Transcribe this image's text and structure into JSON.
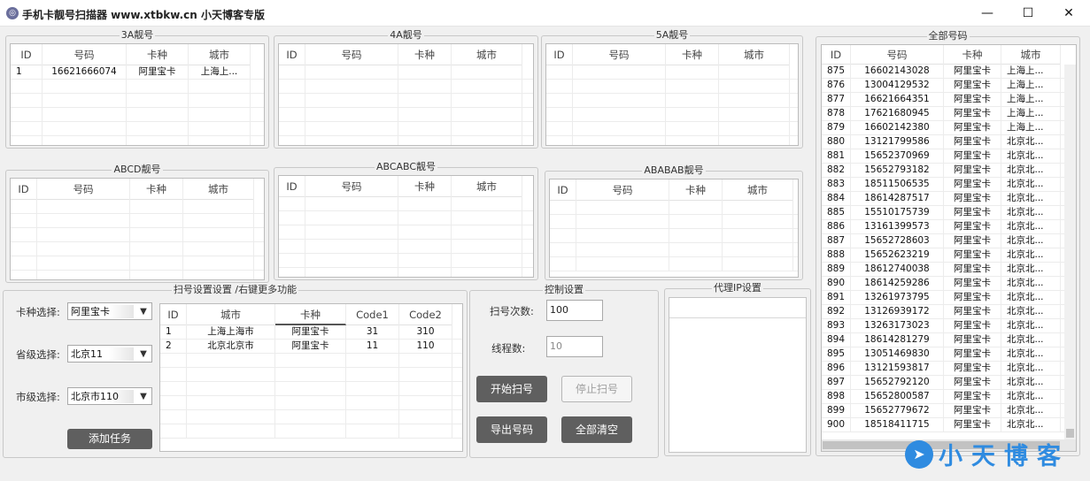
{
  "window": {
    "title": "手机卡靓号扫描器  www.xtbkw.cn  小天博客专版",
    "minimize": "—",
    "maximize": "☐",
    "close": "✕"
  },
  "groups": {
    "g3a": "3A靓号",
    "g4a": "4A靓号",
    "g5a": "5A靓号",
    "gabcd": "ABCD靓号",
    "gabcabc": "ABCABC靓号",
    "gababab": "ABABAB靓号",
    "gall": "全部号码",
    "gscan": "扫号设置设置 /右键更多功能",
    "gctrl": "控制设置",
    "gproxy": "代理IP设置"
  },
  "grid_headers": {
    "id": "ID",
    "number": "号码",
    "card": "卡种",
    "city": "城市"
  },
  "grid_3a_rows": [
    {
      "id": "1",
      "number": "16621666074",
      "card": "阿里宝卡",
      "city": "上海上..."
    }
  ],
  "settings": {
    "card_label": "卡种选择:",
    "card_value": "阿里宝卡",
    "province_label": "省级选择:",
    "province_value": "北京11",
    "city_label": "市级选择:",
    "city_value": "北京市110",
    "add_task": "添加任务"
  },
  "task_grid": {
    "headers": {
      "id": "ID",
      "city": "城市",
      "card": "卡种",
      "code1": "Code1",
      "code2": "Code2"
    },
    "rows": [
      {
        "id": "1",
        "city": "上海上海市",
        "card": "阿里宝卡",
        "code1": "31",
        "code2": "310"
      },
      {
        "id": "2",
        "city": "北京北京市",
        "card": "阿里宝卡",
        "code1": "11",
        "code2": "110"
      }
    ]
  },
  "control": {
    "scan_count_label": "扫号次数:",
    "scan_count_value": "100",
    "threads_label": "线程数:",
    "threads_value": "10",
    "start": "开始扫号",
    "stop": "停止扫号",
    "export": "导出号码",
    "clear": "全部清空"
  },
  "all_numbers": [
    {
      "id": "875",
      "number": "16602143028",
      "card": "阿里宝卡",
      "city": "上海上..."
    },
    {
      "id": "876",
      "number": "13004129532",
      "card": "阿里宝卡",
      "city": "上海上..."
    },
    {
      "id": "877",
      "number": "16621664351",
      "card": "阿里宝卡",
      "city": "上海上..."
    },
    {
      "id": "878",
      "number": "17621680945",
      "card": "阿里宝卡",
      "city": "上海上..."
    },
    {
      "id": "879",
      "number": "16602142380",
      "card": "阿里宝卡",
      "city": "上海上..."
    },
    {
      "id": "880",
      "number": "13121799586",
      "card": "阿里宝卡",
      "city": "北京北..."
    },
    {
      "id": "881",
      "number": "15652370969",
      "card": "阿里宝卡",
      "city": "北京北..."
    },
    {
      "id": "882",
      "number": "15652793182",
      "card": "阿里宝卡",
      "city": "北京北..."
    },
    {
      "id": "883",
      "number": "18511506535",
      "card": "阿里宝卡",
      "city": "北京北..."
    },
    {
      "id": "884",
      "number": "18614287517",
      "card": "阿里宝卡",
      "city": "北京北..."
    },
    {
      "id": "885",
      "number": "15510175739",
      "card": "阿里宝卡",
      "city": "北京北..."
    },
    {
      "id": "886",
      "number": "13161399573",
      "card": "阿里宝卡",
      "city": "北京北..."
    },
    {
      "id": "887",
      "number": "15652728603",
      "card": "阿里宝卡",
      "city": "北京北..."
    },
    {
      "id": "888",
      "number": "15652623219",
      "card": "阿里宝卡",
      "city": "北京北..."
    },
    {
      "id": "889",
      "number": "18612740038",
      "card": "阿里宝卡",
      "city": "北京北..."
    },
    {
      "id": "890",
      "number": "18614259286",
      "card": "阿里宝卡",
      "city": "北京北..."
    },
    {
      "id": "891",
      "number": "13261973795",
      "card": "阿里宝卡",
      "city": "北京北..."
    },
    {
      "id": "892",
      "number": "13126939172",
      "card": "阿里宝卡",
      "city": "北京北..."
    },
    {
      "id": "893",
      "number": "13263173023",
      "card": "阿里宝卡",
      "city": "北京北..."
    },
    {
      "id": "894",
      "number": "18614281279",
      "card": "阿里宝卡",
      "city": "北京北..."
    },
    {
      "id": "895",
      "number": "13051469830",
      "card": "阿里宝卡",
      "city": "北京北..."
    },
    {
      "id": "896",
      "number": "13121593817",
      "card": "阿里宝卡",
      "city": "北京北..."
    },
    {
      "id": "897",
      "number": "15652792120",
      "card": "阿里宝卡",
      "city": "北京北..."
    },
    {
      "id": "898",
      "number": "15652800587",
      "card": "阿里宝卡",
      "city": "北京北..."
    },
    {
      "id": "899",
      "number": "15652779672",
      "card": "阿里宝卡",
      "city": "北京北..."
    },
    {
      "id": "900",
      "number": "18518411715",
      "card": "阿里宝卡",
      "city": "北京北..."
    }
  ],
  "watermark": {
    "text": "小天博客",
    "icon": "paper-plane-icon"
  },
  "colors": {
    "accent": "#2f8be0",
    "button_dark": "#5f5f5f"
  }
}
